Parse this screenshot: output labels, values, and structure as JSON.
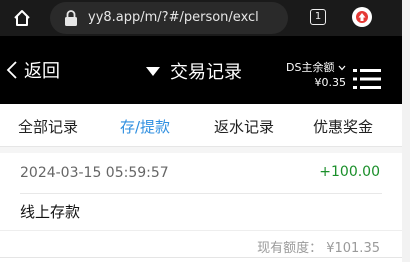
{
  "browser": {
    "url": "yy8.app/m/?#/person/excl",
    "tab_count": "1",
    "icons": [
      "home-icon",
      "lock-icon",
      "tabs-icon",
      "upload-icon"
    ]
  },
  "nav": {
    "back_label": "返回",
    "title": "交易记录",
    "balance_label": "DS主余额",
    "balance_value": "¥0.35",
    "icons": [
      "chevron-left-icon",
      "dropdown-triangle-icon",
      "menu-icon"
    ]
  },
  "tabs": [
    {
      "label": "全部记录",
      "active": false
    },
    {
      "label": "存/提款",
      "active": true
    },
    {
      "label": "返水记录",
      "active": false
    },
    {
      "label": "优惠奖金",
      "active": false
    }
  ],
  "records": [
    {
      "date": "2024-03-15 05:59:57",
      "amount": "+100.00",
      "type": "线上存款",
      "balance": "现有额度： ¥101.35"
    }
  ],
  "colors": {
    "active_tab": "#2f8fe0",
    "positive_amount": "#1a8f2a",
    "header_bg": "#000000",
    "browser_bg": "#1a1a1a"
  }
}
